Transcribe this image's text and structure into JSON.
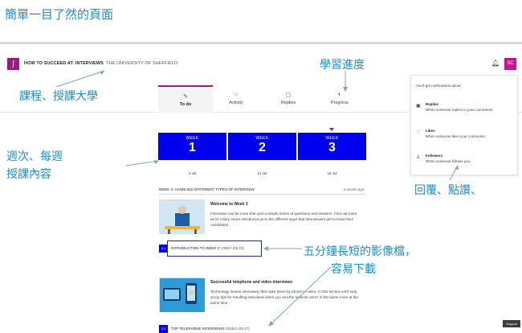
{
  "annotations": {
    "top_caption": "簡單一目了然的頁面",
    "course_caption": "課程、授課大學",
    "progress_caption": "學習進度",
    "week_caption_line1": "週次、每週",
    "week_caption_line2": "授課內容",
    "reply_caption": "回覆、點讚、",
    "video_caption_line1": "五分鐘長短的影像檔，",
    "video_caption_line2": "容易下載"
  },
  "header": {
    "logo_glyph": "∫",
    "course_title": "HOW TO SUCCEED AT: INTERVIEWS",
    "university": "THE UNIVERSITY OF SHEFFIELD",
    "avatar_initials": "SC"
  },
  "tabs": [
    {
      "label": "To do",
      "icon": "edit-icon",
      "glyph": "✎",
      "active": true
    },
    {
      "label": "Activity",
      "icon": "activity-icon",
      "glyph": "○",
      "active": false
    },
    {
      "label": "Replies",
      "icon": "replies-icon",
      "glyph": "▢",
      "active": false
    },
    {
      "label": "Progress",
      "icon": "progress-icon",
      "glyph": "◐",
      "active": false
    }
  ],
  "notifications": {
    "header": "You'll get notifications about:",
    "items": [
      {
        "title": "Replies",
        "desc": "When someone replies to your comments.",
        "glyph": "▣"
      },
      {
        "title": "Likes",
        "desc": "When someone likes your comments.",
        "glyph": "♡"
      },
      {
        "title": "Followers",
        "desc": "When someone follows you.",
        "glyph": "♙"
      }
    ]
  },
  "weeks": [
    {
      "label": "WEEK",
      "number": "1",
      "date": "4 Jul"
    },
    {
      "label": "WEEK",
      "number": "2",
      "date": "11 Jul"
    },
    {
      "label": "WEEK",
      "number": "3",
      "date": "18 Jul"
    }
  ],
  "section": {
    "title": "WEEK 3: HANDLING DIFFERENT TYPES OF INTERVIEW",
    "ago": "6 weeks ago"
  },
  "cards": [
    {
      "title": "Welcome to Week 3",
      "desc": "Interviews can be more than just a simple series of questions and answers. Find out more as Dr Hilary Jones introduces us to the different ways that interviewers get to know their candidates."
    },
    {
      "title": "Successful telephone and video interviews",
      "desc": "Technology means interviews often take place by phone or video. In this section we'll look at top tips for handling interviews when you and the selector aren't in the same room at the same time."
    }
  ],
  "steps": [
    {
      "num": "3.1",
      "title": "INTRODUCTION TO WEEK 3",
      "meta": "VIDEO (05:23)"
    },
    {
      "num": "3.3",
      "title": "TOP TELEPHONE INTERVIEWS",
      "meta": "VIDEO (03:17)"
    }
  ],
  "support_label": "Support",
  "colors": {
    "accent": "#9b1b7e",
    "week_blue": "#0000ee",
    "annotation": "#1a8fd1"
  }
}
